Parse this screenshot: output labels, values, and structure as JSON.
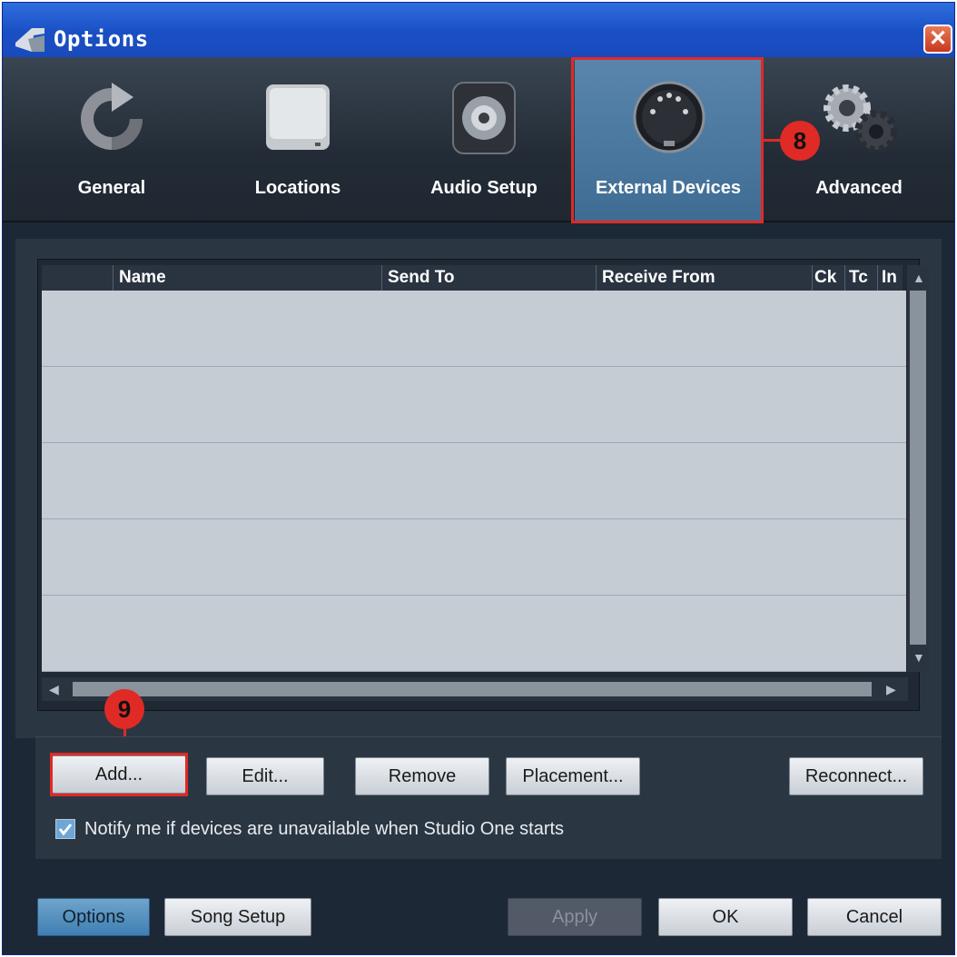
{
  "window": {
    "title": "Options",
    "close_symbol": "✕"
  },
  "tabs": [
    {
      "label": "General",
      "icon": "refresh-icon"
    },
    {
      "label": "Locations",
      "icon": "hard-drive-icon"
    },
    {
      "label": "Audio Setup",
      "icon": "speaker-icon"
    },
    {
      "label": "External Devices",
      "icon": "midi-connector-icon",
      "active": true
    },
    {
      "label": "Advanced",
      "icon": "gears-icon"
    }
  ],
  "callouts": {
    "tab_badge": "8",
    "add_badge": "9"
  },
  "table": {
    "columns": [
      "Name",
      "Send To",
      "Receive From",
      "Ck",
      "Tc",
      "In"
    ],
    "rows": []
  },
  "actions": {
    "add": "Add...",
    "edit": "Edit...",
    "remove": "Remove",
    "placement": "Placement...",
    "reconnect": "Reconnect..."
  },
  "notify": {
    "checked": true,
    "label": "Notify me if devices are unavailable when Studio One starts"
  },
  "footer": {
    "options": "Options",
    "song_setup": "Song Setup",
    "apply": "Apply",
    "ok": "OK",
    "cancel": "Cancel"
  },
  "colors": {
    "highlight": "#e02a25",
    "active_tab": "#4a7aa3",
    "window_frame": "#1746b8"
  }
}
